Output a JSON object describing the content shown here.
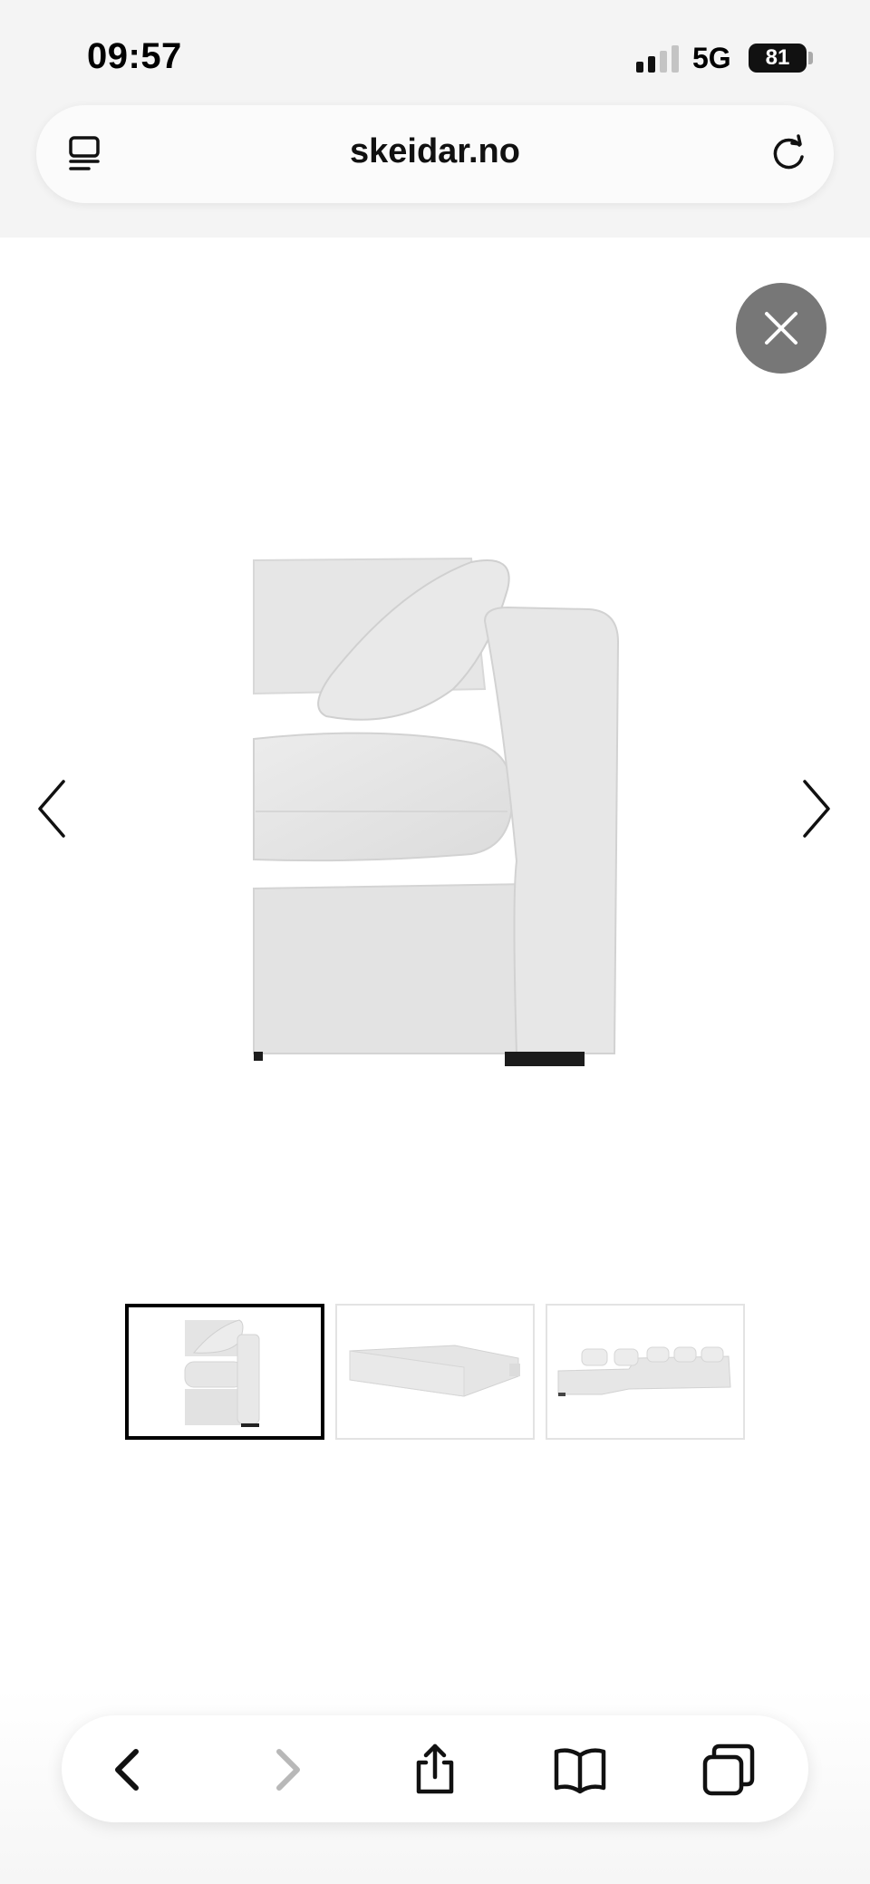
{
  "status_bar": {
    "time": "09:57",
    "network": "5G",
    "battery_level": "81",
    "signal_bars_filled": 2,
    "signal_bars_total": 4
  },
  "url_bar": {
    "domain": "skeidar.no",
    "left_icon": "tabs-list-icon",
    "right_icon": "reload-icon"
  },
  "gallery": {
    "close_icon": "close-icon",
    "prev_icon": "chevron-left-icon",
    "next_icon": "chevron-right-icon",
    "thumbnails": [
      {
        "subject": "sofa-corner-module",
        "active": true
      },
      {
        "subject": "sofa-back-view",
        "active": false
      },
      {
        "subject": "corner-sofa-full-view",
        "active": false
      }
    ]
  },
  "toolbar": {
    "buttons": [
      "back",
      "forward",
      "share",
      "bookmarks",
      "tabs"
    ],
    "forward_enabled": false
  },
  "colors": {
    "close_button_bg": "#777777",
    "sofa_fabric": "#e6e6e6",
    "active_thumb_border": "#000000"
  }
}
